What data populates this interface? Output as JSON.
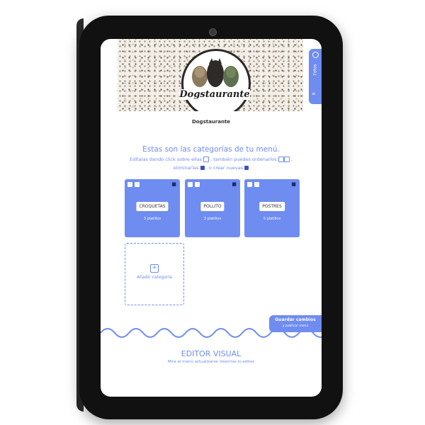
{
  "brand": {
    "logo_text": "Dogstaurante",
    "name": "Dogstaurante"
  },
  "side_tab": {
    "label": "Fotos"
  },
  "intro": {
    "headline": "Estas son las categorías de tu menú.",
    "line1": "Edítalas dando click sobre ellas",
    "line1b": ", también puedes ordenarlos",
    "line2a": "eliminarlas",
    "line2b": ", o crear nuevas"
  },
  "categories": [
    {
      "name": "CROQUETAS",
      "count": "3 platillos"
    },
    {
      "name": "POLLITO",
      "count": "3 platillos"
    },
    {
      "name": "POSTRES",
      "count": "5 platillos"
    }
  ],
  "add_category": {
    "label": "Añadir categoría"
  },
  "save_button": {
    "line1": "Guardar cambios",
    "line2": "y publicar menú"
  },
  "editor": {
    "title": "EDITOR VISUAL",
    "subtitle": "Mira el menú actualizarse mientras lo editas"
  },
  "colors": {
    "accent": "#6f8cf0",
    "dark_accent": "#1d2a6e",
    "bezel": "#111111"
  }
}
